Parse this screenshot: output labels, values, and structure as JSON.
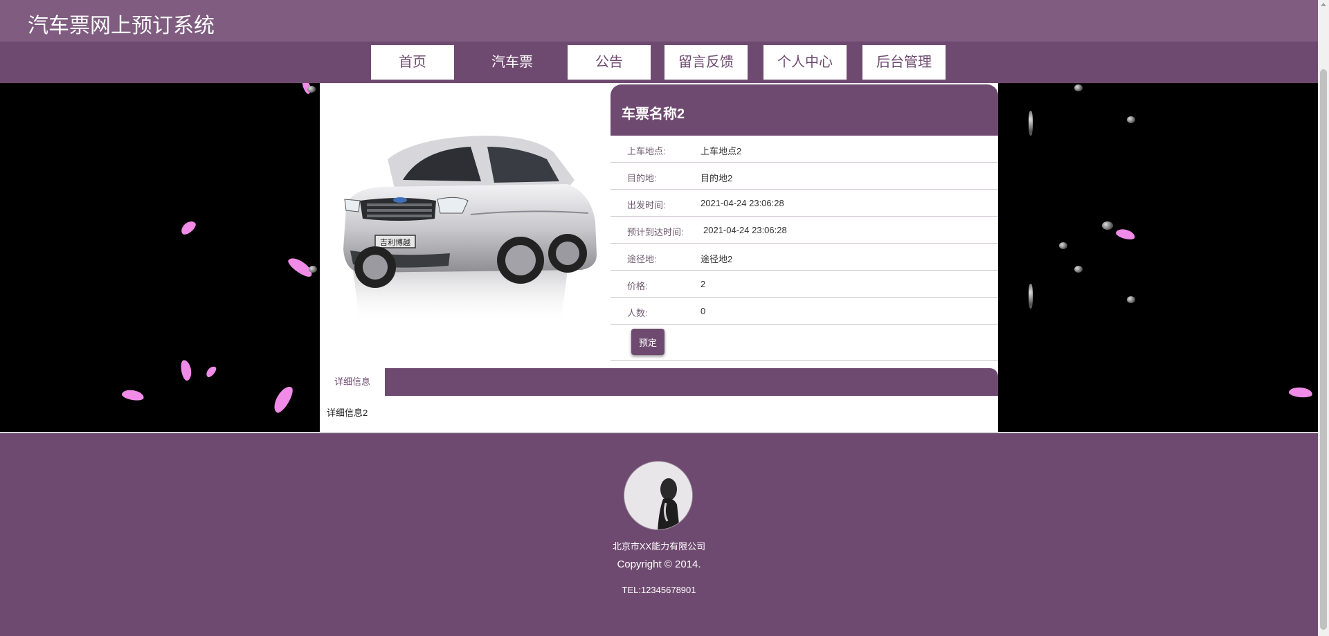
{
  "header": {
    "site_title": "汽车票网上预订系统"
  },
  "nav": {
    "items": [
      {
        "label": "首页"
      },
      {
        "label": "汽车票",
        "active": true
      },
      {
        "label": "公告"
      },
      {
        "label": "留言反馈"
      },
      {
        "label": "个人中心"
      },
      {
        "label": "后台管理"
      }
    ]
  },
  "ticket": {
    "name": "车票名称2",
    "fields": [
      {
        "label": "上车地点:",
        "value": "上车地点2"
      },
      {
        "label": "目的地:",
        "value": "目的地2"
      },
      {
        "label": "出发时间:",
        "value": "2021-04-24 23:06:28"
      },
      {
        "label": "预计到达时间:",
        "value": "2021-04-24 23:06:28"
      },
      {
        "label": "途径地:",
        "value": "途径地2"
      },
      {
        "label": "价格:",
        "value": "2"
      },
      {
        "label": "人数:",
        "value": "0"
      }
    ],
    "book_label": "预定",
    "car_badge": "吉利博越"
  },
  "details": {
    "tab_label": "详细信息",
    "text": "详细信息2"
  },
  "footer": {
    "company": "北京市XX能力有限公司",
    "copyright": "Copyright © 2014.",
    "tel": "TEL:12345678901"
  },
  "colors": {
    "topbar": "#7f5c80",
    "primary": "#6f4a70",
    "petal": "#f08be8"
  }
}
